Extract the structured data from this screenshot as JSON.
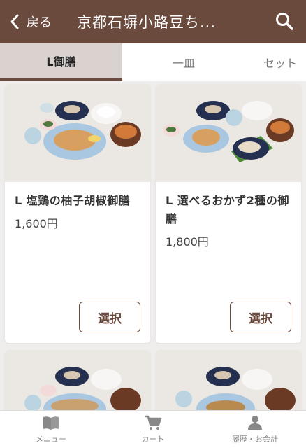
{
  "header": {
    "back_label": "戻る",
    "title": "京都石塀小路豆ち..."
  },
  "tabs": [
    {
      "label": "L御膳",
      "active": true
    },
    {
      "label": "一皿",
      "active": false
    },
    {
      "label": "セット",
      "active": false
    }
  ],
  "items": [
    {
      "name": "L 塩鶏の柚子胡椒御膳",
      "price": "1,600円",
      "button": "選択"
    },
    {
      "name": "L 選べるおかず2種の御膳",
      "price": "1,800円",
      "button": "選択"
    }
  ],
  "bottom_nav": [
    {
      "label": "メニュー",
      "icon": "book-icon"
    },
    {
      "label": "カート",
      "icon": "cart-icon"
    },
    {
      "label": "履歴・お会計",
      "icon": "person-icon"
    }
  ],
  "colors": {
    "brand": "#6b4a3e",
    "tab_active_bg": "#d9d2ce"
  }
}
